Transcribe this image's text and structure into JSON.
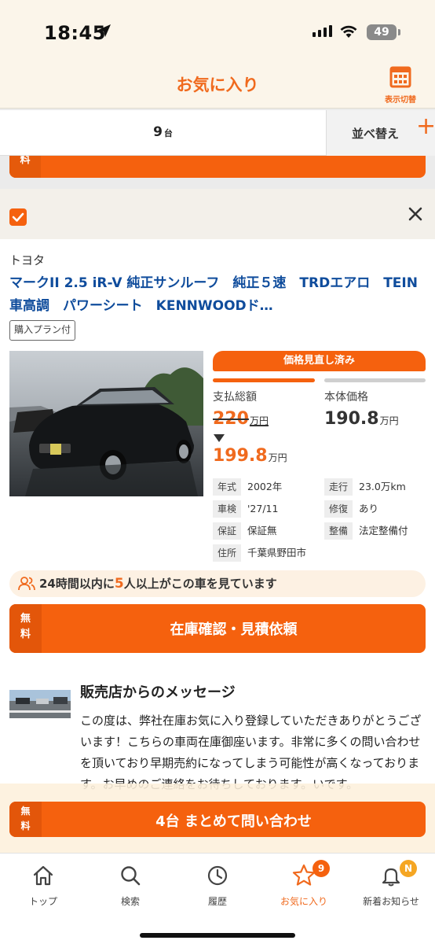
{
  "status_bar": {
    "time": "18:45",
    "battery": "49"
  },
  "header": {
    "title": "お気に入り",
    "view_toggle_label": "表示切替"
  },
  "list_bar": {
    "count": "9",
    "count_unit": "台",
    "sort_label": "並べ替え"
  },
  "prev_card": {
    "free_label": "料"
  },
  "card": {
    "maker": "トヨタ",
    "title": "マークII 2.5 iR-V 純正サンルーフ　純正５速　TRDエアロ　TEIN車高調　パワーシート　KENNWOODド…",
    "plan_badge": "購入プラン付",
    "price_revised_label": "価格見直し済み",
    "total_label": "支払総額",
    "body_label": "本体価格",
    "old_total": "220",
    "new_total": "199.8",
    "body_price": "190.8",
    "price_unit": "万円",
    "specs": [
      {
        "key": "年式",
        "value": "2002年"
      },
      {
        "key": "走行",
        "value": "23.0万km"
      },
      {
        "key": "車検",
        "value": "'27/11"
      },
      {
        "key": "修復",
        "value": "あり"
      },
      {
        "key": "保証",
        "value": "保証無"
      },
      {
        "key": "整備",
        "value": "法定整備付"
      },
      {
        "key": "住所",
        "value": "千葉県野田市"
      }
    ],
    "views_prefix": "24時間以内に",
    "views_count": "5",
    "views_suffix": "人以上がこの車を見ています",
    "cta_free": "無料",
    "cta_label": "在庫確認・見積依頼",
    "message_title": "販売店からのメッセージ",
    "message_body": "この度は、弊社在庫お気に入り登録していただきありがとうございます！こちらの車両在庫御座います。非常に多くの問い合わせを頂いており早期売約になってしまう可能性が高くなっております。お早めのご連絡をお待ちしております。いです。"
  },
  "footer_cta": {
    "free": "無料",
    "label": "4台 まとめて問い合わせ"
  },
  "tabbar": {
    "items": [
      {
        "label": "トップ"
      },
      {
        "label": "検索"
      },
      {
        "label": "履歴"
      },
      {
        "label": "お気に入り",
        "badge": "9"
      },
      {
        "label": "新着お知らせ",
        "badge": "N"
      }
    ]
  },
  "colors": {
    "accent": "#f5610e",
    "title_link": "#0f4c9c",
    "header_bg": "#fbf5ea"
  }
}
